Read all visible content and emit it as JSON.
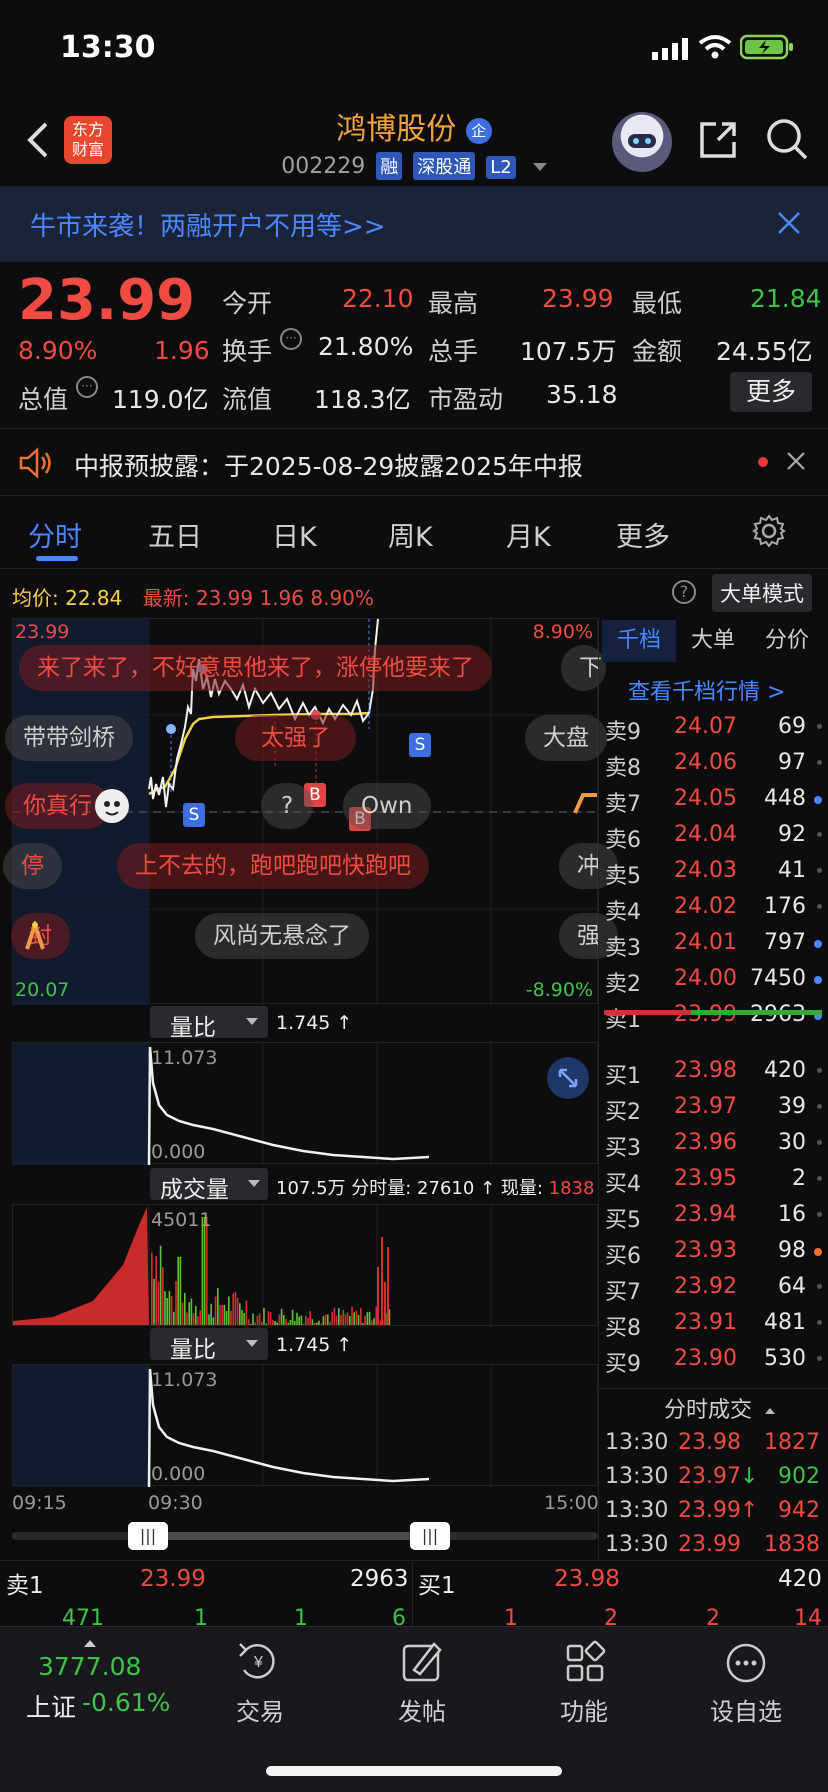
{
  "status_bar": {
    "time": "13:30"
  },
  "header": {
    "stock_name": "鸿博股份",
    "name_badge": "企",
    "code": "002229",
    "tags": [
      "融",
      "深股通",
      "L2"
    ],
    "logo_text": [
      "东方",
      "财富"
    ]
  },
  "banner": {
    "text": "牛市来袭！两融开户不用等>>"
  },
  "quote": {
    "price": "23.99",
    "pct": "8.90%",
    "change": "1.96",
    "rows": [
      [
        [
          "今开",
          "22.10",
          "red"
        ],
        [
          "最高",
          "23.99",
          "red"
        ],
        [
          "最低",
          "21.84",
          "green"
        ]
      ],
      [
        [
          "换手",
          "21.80%",
          "white"
        ],
        [
          "总手",
          "107.5万",
          "white"
        ],
        [
          "金额",
          "24.55亿",
          "white"
        ]
      ],
      [
        [
          "总值",
          "119.0亿",
          "white"
        ],
        [
          "流值",
          "118.3亿",
          "white"
        ],
        [
          "市盈动",
          "35.18",
          "white"
        ]
      ]
    ],
    "more_label": "更多"
  },
  "notice": {
    "text": "中报预披露：于2025-08-29披露2025年中报"
  },
  "tabs": [
    "分时",
    "五日",
    "日K",
    "周K",
    "月K",
    "更多"
  ],
  "chart_header": {
    "avg_label": "均价:",
    "avg_value": "22.84",
    "latest_label": "最新:",
    "latest_value": "23.99",
    "latest_change": "1.96",
    "latest_pct": "8.90%",
    "big_order_mode": "大单模式"
  },
  "price_chart": {
    "top_left": "23.99",
    "top_right": "8.90%",
    "bottom_left": "20.07",
    "bottom_right": "-8.90%"
  },
  "danmaku": [
    "来了来了，不好意思他来了，涨停他要来了",
    "下",
    "带带剑桥",
    "太强了",
    "大盘",
    "你真行",
    "?",
    "Own",
    "停",
    "上不去的，跑吧跑吧快跑吧",
    "冲",
    "封",
    "风尚无悬念了",
    "强"
  ],
  "indicator1": {
    "label": "量比",
    "value": "1.745 ↑",
    "max": "11.073",
    "min": "0.000"
  },
  "volume": {
    "label": "成交量",
    "total": "107.5万",
    "detail": "分时量: 27610 ↑ 现量:",
    "current": "1838",
    "max": "45011"
  },
  "indicator2": {
    "label": "量比",
    "value": "1.745 ↑",
    "max": "11.073",
    "min": "0.000"
  },
  "time_axis": {
    "start": "09:15",
    "open": "09:30",
    "end": "15:00"
  },
  "order_book": {
    "tabs": [
      "千档",
      "大单",
      "分价"
    ],
    "link": "查看千档行情 >",
    "asks": [
      [
        "卖9",
        "24.07",
        "69",
        ""
      ],
      [
        "卖8",
        "24.06",
        "97",
        ""
      ],
      [
        "卖7",
        "24.05",
        "448",
        "blue"
      ],
      [
        "卖6",
        "24.04",
        "92",
        ""
      ],
      [
        "卖5",
        "24.03",
        "41",
        ""
      ],
      [
        "卖4",
        "24.02",
        "176",
        ""
      ],
      [
        "卖3",
        "24.01",
        "797",
        "blue"
      ],
      [
        "卖2",
        "24.00",
        "7450",
        "blue"
      ],
      [
        "卖1",
        "23.99",
        "2963",
        "blue"
      ]
    ],
    "bids": [
      [
        "买1",
        "23.98",
        "420",
        ""
      ],
      [
        "买2",
        "23.97",
        "39",
        ""
      ],
      [
        "买3",
        "23.96",
        "30",
        ""
      ],
      [
        "买4",
        "23.95",
        "2",
        ""
      ],
      [
        "买5",
        "23.94",
        "16",
        ""
      ],
      [
        "买6",
        "23.93",
        "98",
        "orange"
      ],
      [
        "买7",
        "23.92",
        "64",
        ""
      ],
      [
        "买8",
        "23.91",
        "481",
        ""
      ],
      [
        "买9",
        "23.90",
        "530",
        ""
      ]
    ],
    "ticks_title": "分时成交",
    "ticks": [
      [
        "13:30",
        "23.98",
        "",
        "1827",
        "red"
      ],
      [
        "13:30",
        "23.97",
        "↓",
        "902",
        "green"
      ],
      [
        "13:30",
        "23.99",
        "↑",
        "942",
        "red"
      ],
      [
        "13:30",
        "23.99",
        "",
        "1838",
        "red"
      ]
    ]
  },
  "level1": {
    "sell_label": "卖1",
    "sell_price": "23.99",
    "sell_vol": "2963",
    "buy_label": "买1",
    "buy_price": "23.98",
    "buy_vol": "420",
    "partial_left": [
      "471",
      "1",
      "1",
      "6"
    ],
    "partial_right": [
      "1",
      "2",
      "2",
      "14"
    ]
  },
  "bottom_nav": {
    "index_value": "3777.08",
    "index_name": "上证",
    "index_pct": "-0.61%",
    "items": [
      "交易",
      "发帖",
      "功能",
      "设自选"
    ]
  }
}
